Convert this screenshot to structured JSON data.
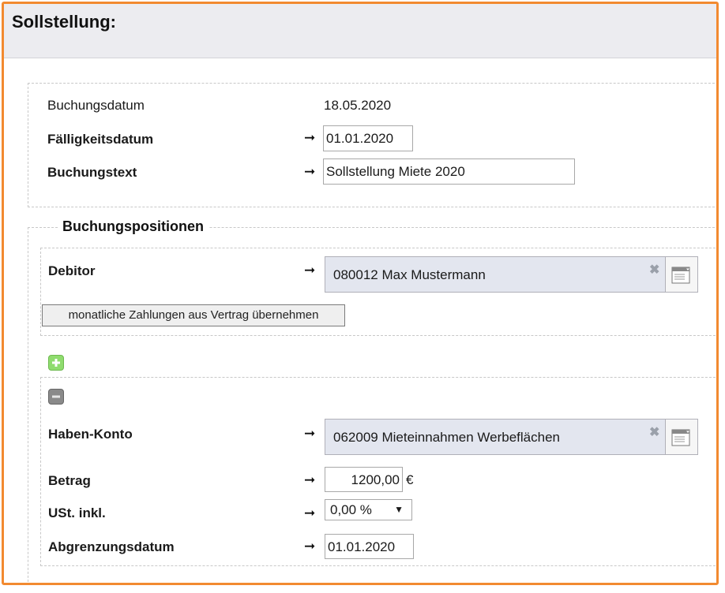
{
  "header": {
    "title": "Sollstellung:"
  },
  "booking": {
    "buchungsdatum_label": "Buchungsdatum",
    "buchungsdatum_value": "18.05.2020",
    "faelligkeitsdatum_label": "Fälligkeitsdatum",
    "faelligkeitsdatum_value": "01.01.2020",
    "buchungstext_label": "Buchungstext",
    "buchungstext_value": "Sollstellung Miete 2020"
  },
  "positions": {
    "section_title": "Buchungspositionen",
    "debitor_label": "Debitor",
    "debitor_value": "080012 Max Mustermann",
    "monthly_button": "monatliche Zahlungen aus Vertrag übernehmen",
    "haben_konto_label": "Haben-Konto",
    "haben_konto_value": "062009 Mieteinnahmen Werbeflächen",
    "betrag_label": "Betrag",
    "betrag_value": "1200,00",
    "currency": "€",
    "ust_label": "USt. inkl.",
    "ust_value": "0,00 %",
    "abgrenzung_label": "Abgrenzungsdatum",
    "abgrenzung_value": "01.01.2020"
  },
  "glyphs": {
    "arrow": "➞",
    "clear": "✖",
    "caret": "▼"
  },
  "colors": {
    "frame": "#f28a30",
    "add_icon": "#8fdc6e",
    "remove_icon": "#8a8a8a",
    "picker_bg": "#e3e6ef"
  }
}
